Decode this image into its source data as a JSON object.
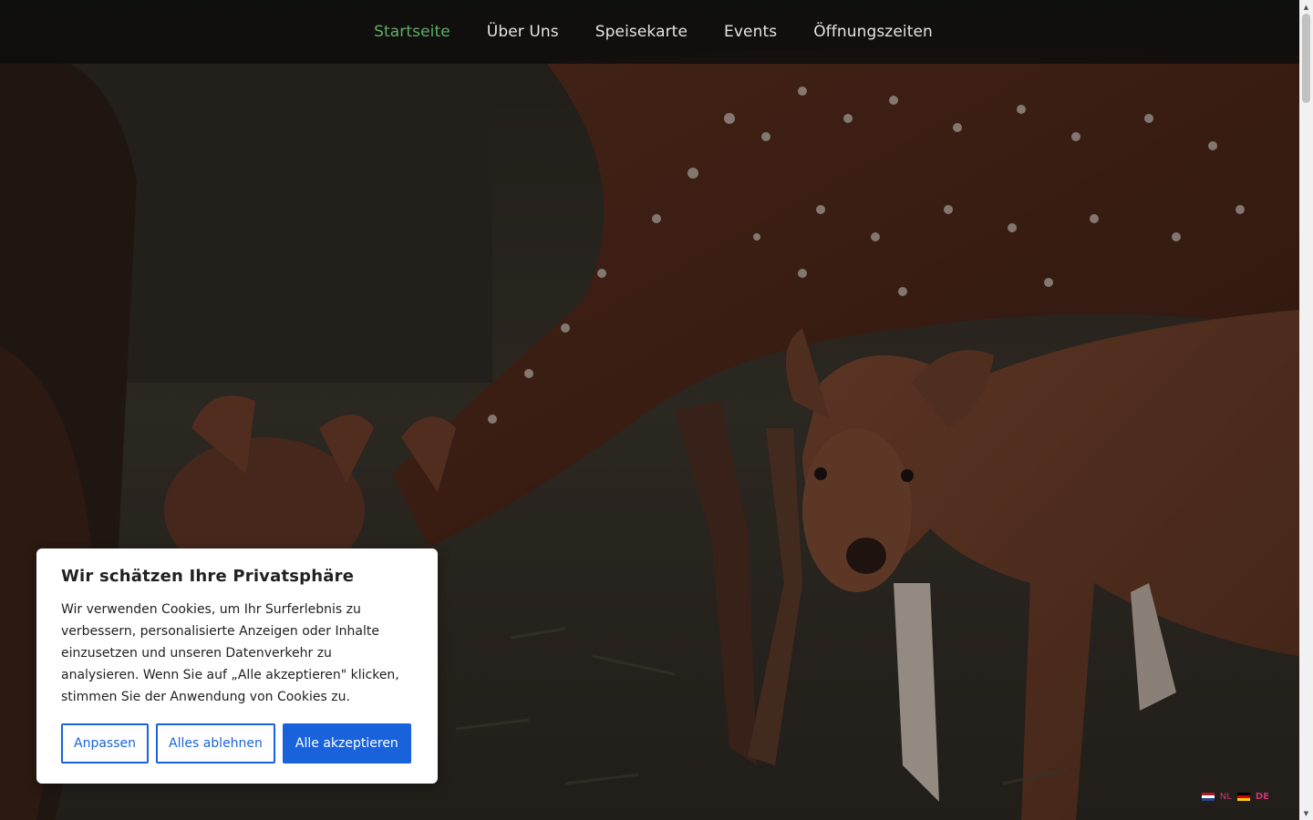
{
  "nav": {
    "items": [
      {
        "label": "Startseite",
        "active": true
      },
      {
        "label": "Über Uns",
        "active": false
      },
      {
        "label": "Speisekarte",
        "active": false
      },
      {
        "label": "Events",
        "active": false
      },
      {
        "label": "Öffnungszeiten",
        "active": false
      }
    ],
    "active_color": "#5fae63"
  },
  "cookie_banner": {
    "title": "Wir schätzen Ihre Privatsphäre",
    "text": "Wir verwenden Cookies, um Ihr Surferlebnis zu verbessern, personalisierte Anzeigen oder Inhalte einzusetzen und unseren Datenverkehr zu analysieren. Wenn Sie auf „Alle akzeptieren\" klicken, stimmen Sie der Anwendung von Cookies zu.",
    "customize_label": "Anpassen",
    "reject_label": "Alles ablehnen",
    "accept_label": "Alle akzeptieren",
    "accent_color": "#1863dc"
  },
  "language_switcher": {
    "languages": [
      {
        "code": "NL",
        "icon": "netherlands-flag-icon",
        "active": false
      },
      {
        "code": "DE",
        "icon": "germany-flag-icon",
        "active": true
      }
    ]
  },
  "hero": {
    "image": "deer-herd-photo"
  }
}
